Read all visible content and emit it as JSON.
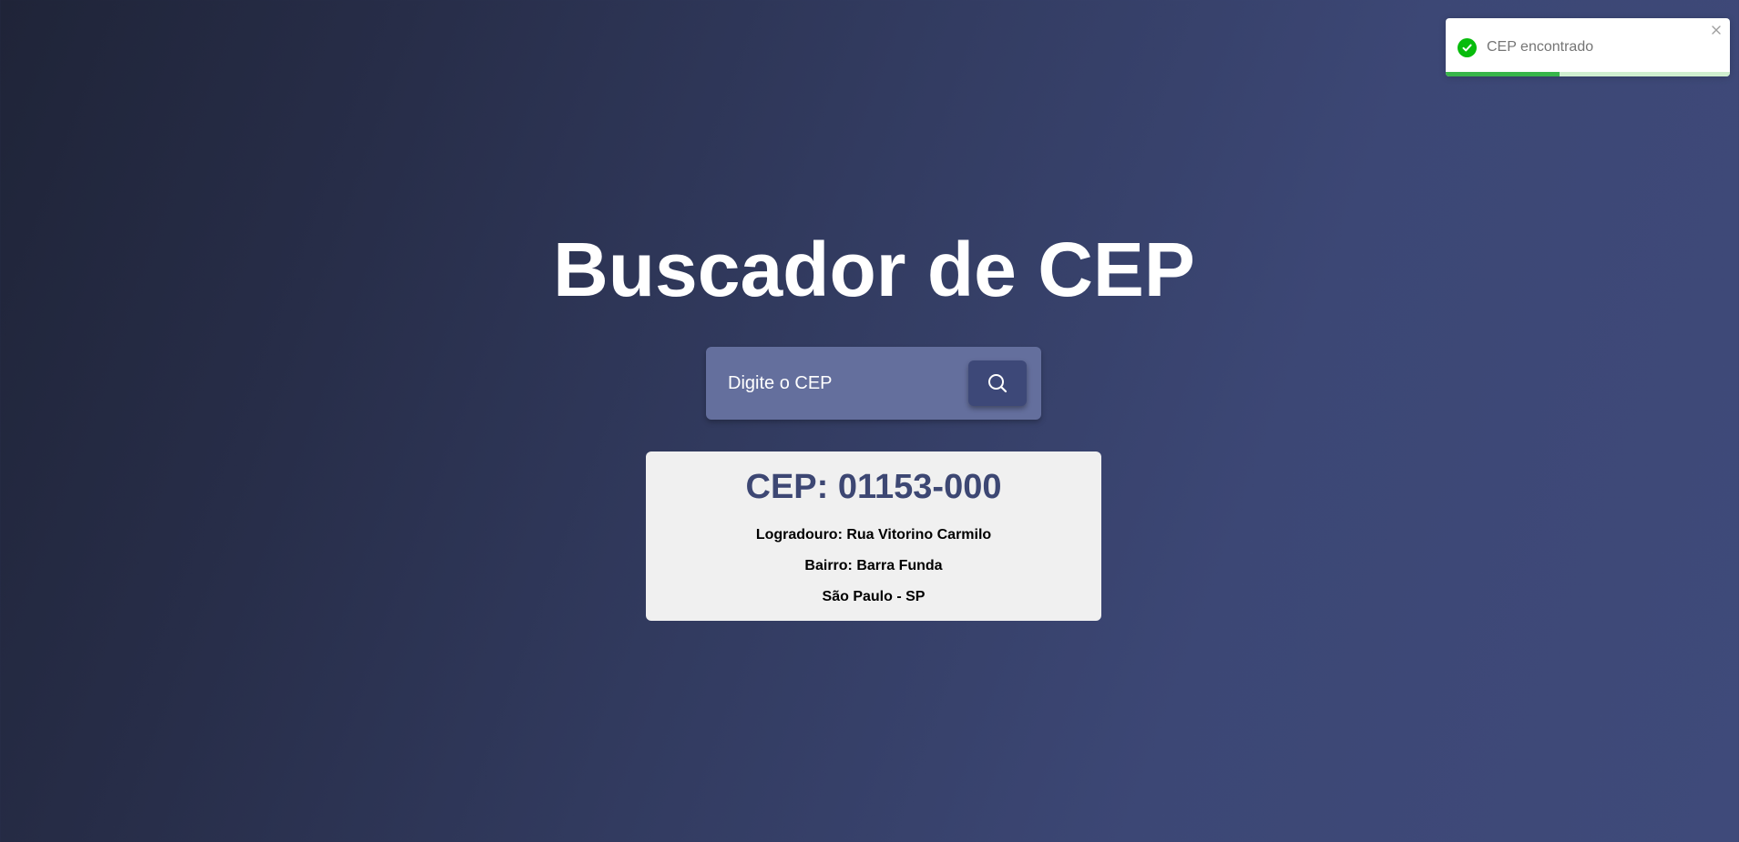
{
  "toast": {
    "message": "CEP encontrado",
    "type": "success",
    "icon": "check-circle-icon",
    "close_icon": "close-icon",
    "progress": 0.4,
    "accent_color": "#07bc0c"
  },
  "header": {
    "title": "Buscador de CEP"
  },
  "search": {
    "placeholder": "Digite o CEP",
    "value": "",
    "button_icon": "search-icon"
  },
  "result": {
    "cep_heading": "CEP: 01153-000",
    "logradouro": "Logradouro: Rua Vitorino Carmilo",
    "bairro": "Bairro: Barra Funda",
    "cidade_uf": "São Paulo - SP"
  },
  "colors": {
    "background_dark": "#1f2438",
    "background_light": "#3f4a7a",
    "search_box": "#646f9d",
    "search_button": "#3d4878",
    "card_bg": "#f0f0f0",
    "cep_text": "#3d4773"
  }
}
